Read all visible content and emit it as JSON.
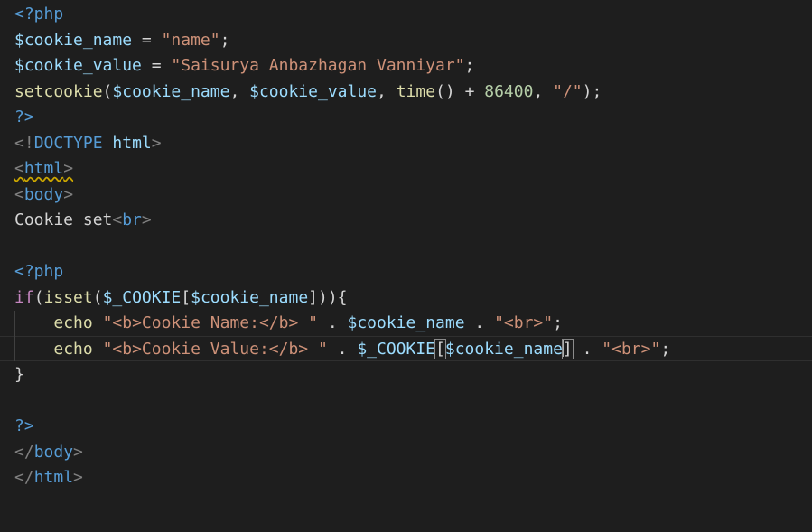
{
  "colors": {
    "background": "#1e1e1e",
    "php_tag": "#569cd6",
    "variable": "#9cdcfe",
    "string": "#ce9178",
    "function": "#dcdcaa",
    "number": "#b5cea8",
    "keyword": "#c586c0",
    "html_bracket": "#808080",
    "plain_text": "#d4d4d4",
    "constant": "#4fc1ff"
  },
  "code_lines": [
    [
      {
        "t": "<?php",
        "c": "php_tag"
      }
    ],
    [
      {
        "t": "$cookie_name",
        "c": "variable"
      },
      {
        "t": " = ",
        "c": "plain_text"
      },
      {
        "t": "\"name\"",
        "c": "string"
      },
      {
        "t": ";",
        "c": "plain_text"
      }
    ],
    [
      {
        "t": "$cookie_value",
        "c": "variable"
      },
      {
        "t": " = ",
        "c": "plain_text"
      },
      {
        "t": "\"Saisurya Anbazhagan Vanniyar\"",
        "c": "string"
      },
      {
        "t": ";",
        "c": "plain_text"
      }
    ],
    [
      {
        "t": "setcookie",
        "c": "function"
      },
      {
        "t": "(",
        "c": "plain_text"
      },
      {
        "t": "$cookie_name",
        "c": "variable"
      },
      {
        "t": ", ",
        "c": "plain_text"
      },
      {
        "t": "$cookie_value",
        "c": "variable"
      },
      {
        "t": ", ",
        "c": "plain_text"
      },
      {
        "t": "time",
        "c": "function"
      },
      {
        "t": "() + ",
        "c": "plain_text"
      },
      {
        "t": "86400",
        "c": "number"
      },
      {
        "t": ", ",
        "c": "plain_text"
      },
      {
        "t": "\"/\"",
        "c": "string"
      },
      {
        "t": ");",
        "c": "plain_text"
      }
    ],
    [
      {
        "t": "?>",
        "c": "php_tag"
      }
    ],
    [
      {
        "t": "<!",
        "c": "html_bracket"
      },
      {
        "t": "DOCTYPE",
        "c": "php_tag"
      },
      {
        "t": " ",
        "c": "plain_text"
      },
      {
        "t": "html",
        "c": "variable"
      },
      {
        "t": ">",
        "c": "html_bracket"
      }
    ],
    [
      {
        "t": "<",
        "c": "html_bracket",
        "squiggle": true
      },
      {
        "t": "html",
        "c": "php_tag",
        "squiggle": true
      },
      {
        "t": ">",
        "c": "html_bracket",
        "squiggle": true
      }
    ],
    [
      {
        "t": "<",
        "c": "html_bracket"
      },
      {
        "t": "body",
        "c": "php_tag"
      },
      {
        "t": ">",
        "c": "html_bracket"
      }
    ],
    [
      {
        "t": "Cookie set",
        "c": "plain_text"
      },
      {
        "t": "<",
        "c": "html_bracket"
      },
      {
        "t": "br",
        "c": "php_tag"
      },
      {
        "t": ">",
        "c": "html_bracket"
      }
    ],
    [],
    [
      {
        "t": "<?php",
        "c": "php_tag"
      }
    ],
    [
      {
        "t": "if",
        "c": "keyword"
      },
      {
        "t": "(",
        "c": "plain_text"
      },
      {
        "t": "isset",
        "c": "function"
      },
      {
        "t": "(",
        "c": "plain_text"
      },
      {
        "t": "$_COOKIE",
        "c": "variable"
      },
      {
        "t": "[",
        "c": "plain_text"
      },
      {
        "t": "$cookie_name",
        "c": "variable"
      },
      {
        "t": "])){",
        "c": "plain_text"
      }
    ],
    [
      {
        "t": "    ",
        "c": "plain_text"
      },
      {
        "t": "echo",
        "c": "function"
      },
      {
        "t": " ",
        "c": "plain_text"
      },
      {
        "t": "\"<b>Cookie Name:</b> \"",
        "c": "string"
      },
      {
        "t": " . ",
        "c": "plain_text"
      },
      {
        "t": "$cookie_name",
        "c": "variable"
      },
      {
        "t": " . ",
        "c": "plain_text"
      },
      {
        "t": "\"<br>\"",
        "c": "string"
      },
      {
        "t": ";",
        "c": "plain_text"
      }
    ],
    [
      {
        "t": "    ",
        "c": "plain_text"
      },
      {
        "t": "echo",
        "c": "function"
      },
      {
        "t": " ",
        "c": "plain_text"
      },
      {
        "t": "\"<b>Cookie Value:</b> \"",
        "c": "string"
      },
      {
        "t": " . ",
        "c": "plain_text"
      },
      {
        "t": "$_COOKIE",
        "c": "variable"
      },
      {
        "t": "[",
        "c": "plain_text",
        "box": true
      },
      {
        "t": "$cookie_name",
        "c": "variable"
      },
      {
        "t": "]",
        "c": "plain_text",
        "box": true,
        "cursor_before": true
      },
      {
        "t": " . ",
        "c": "plain_text"
      },
      {
        "t": "\"<br>\"",
        "c": "string"
      },
      {
        "t": ";",
        "c": "plain_text"
      }
    ],
    [
      {
        "t": "}",
        "c": "plain_text"
      }
    ],
    [],
    [
      {
        "t": "?>",
        "c": "php_tag"
      }
    ],
    [
      {
        "t": "</",
        "c": "html_bracket"
      },
      {
        "t": "body",
        "c": "php_tag"
      },
      {
        "t": ">",
        "c": "html_bracket"
      }
    ],
    [
      {
        "t": "</",
        "c": "html_bracket"
      },
      {
        "t": "html",
        "c": "php_tag"
      },
      {
        "t": ">",
        "c": "html_bracket"
      }
    ]
  ]
}
